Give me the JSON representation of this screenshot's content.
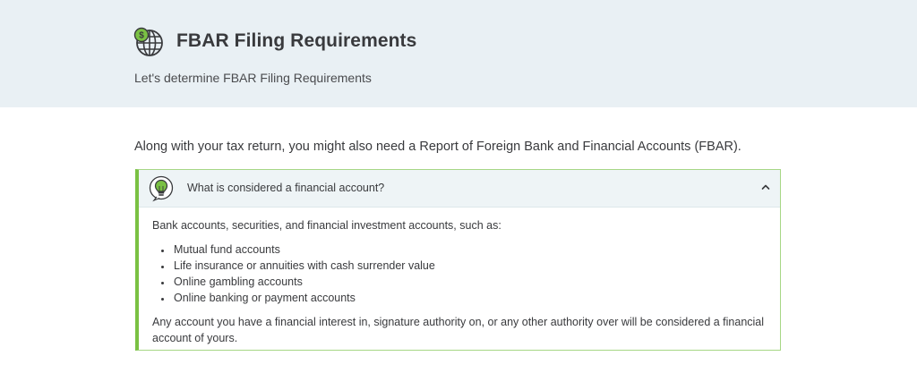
{
  "header": {
    "icon": "globe-dollar-icon",
    "title": "FBAR Filing Requirements",
    "subtitle": "Let's determine FBAR Filing Requirements"
  },
  "intro": "Along with your tax return, you might also need a Report of Foreign Bank and Financial Accounts (FBAR).",
  "accordion": {
    "icon": "lightbulb-icon",
    "question": "What is considered a financial account?",
    "expanded": true,
    "body_intro": "Bank accounts, securities, and financial investment accounts, such as:",
    "items": [
      "Mutual fund accounts",
      "Life insurance or annuities with cash surrender value",
      "Online gambling accounts",
      "Online banking or payment accounts"
    ],
    "body_outro": "Any account you have a financial interest in, signature authority on, or any other authority over will be considered a financial account of yours."
  },
  "colors": {
    "hero_bg": "#e9f0f4",
    "accent_green": "#7ac143",
    "text": "#393a3d"
  }
}
